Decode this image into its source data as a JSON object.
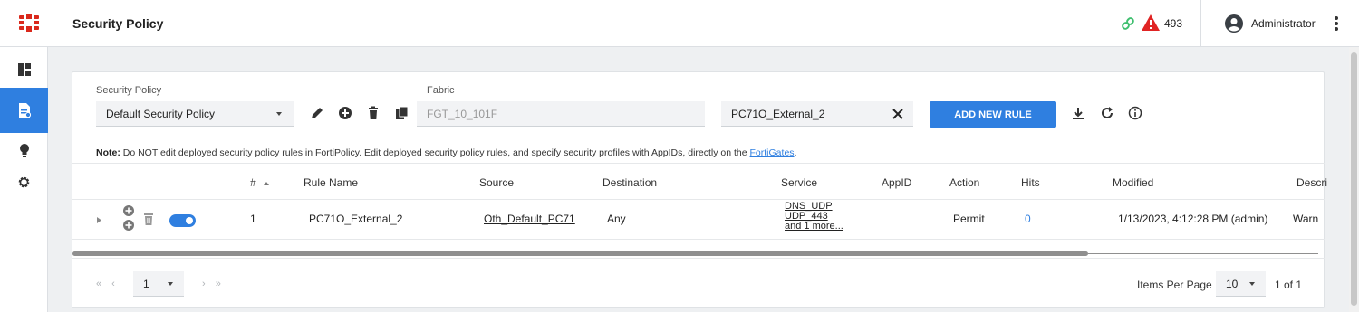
{
  "header": {
    "title": "Security Policy",
    "alert_count": "493",
    "user": "Administrator"
  },
  "sidebar": {
    "items": [
      {
        "icon": "dashboard-icon"
      },
      {
        "icon": "policy-document-icon",
        "active": true
      },
      {
        "icon": "lightbulb-icon"
      },
      {
        "icon": "gear-icon"
      }
    ]
  },
  "toolbar": {
    "policy_label": "Security Policy",
    "policy_value": "Default Security Policy",
    "fabric_label": "Fabric",
    "fabric_value": "FGT_10_101F",
    "filter_value": "PC71O_External_2",
    "add_rule_label": "ADD NEW RULE"
  },
  "note": {
    "prefix": "Note:",
    "text": " Do NOT edit deployed security policy rules in FortiPolicy. Edit deployed security policy rules, and specify security profiles with AppIDs, directly on the ",
    "link": "FortiGates",
    "suffix": "."
  },
  "table": {
    "columns": [
      "#",
      "Rule Name",
      "Source",
      "Destination",
      "Service",
      "AppID",
      "Action",
      "Hits",
      "Modified",
      "Descri"
    ],
    "rows": [
      {
        "num": "1",
        "rule_name": "PC71O_External_2",
        "source": "Oth_Default_PC71",
        "destination": "Any",
        "service": [
          "DNS_UDP",
          "UDP_443",
          "and 1 more..."
        ],
        "appid": "",
        "action": "Permit",
        "hits": "0",
        "modified": "1/13/2023, 4:12:28 PM (admin)",
        "description": "Warn",
        "enabled": true
      }
    ]
  },
  "pagination": {
    "page": "1",
    "items_per_page_label": "Items Per Page",
    "items_per_page": "10",
    "page_count": "1 of 1"
  },
  "colors": {
    "accent": "#2f7fe0",
    "brand": "#da291c",
    "alert": "#e02424",
    "link_status": "#3fbf6f"
  }
}
